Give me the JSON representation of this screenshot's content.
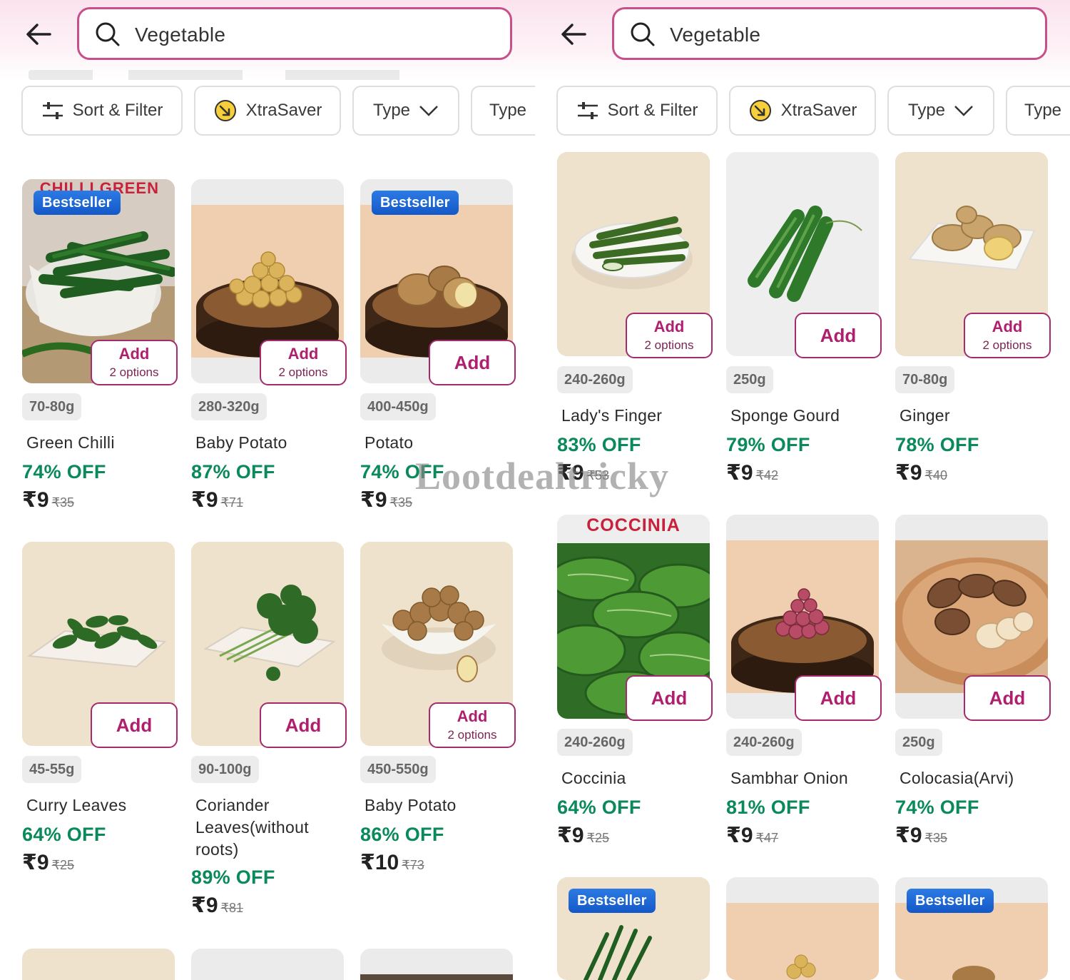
{
  "search": {
    "value": "Vegetable"
  },
  "filters": {
    "sort": "Sort & Filter",
    "xtra": "XtraSaver",
    "type": "Type",
    "type2": "Type"
  },
  "labels": {
    "bestseller": "Bestseller",
    "add": "Add",
    "options": "2 options"
  },
  "watermark": "Lootdealtricky",
  "banners": {
    "chilli": "CHILLI GREEN",
    "coccinia": "COCCINIA"
  },
  "colors": {
    "accent": "#b01f6e",
    "discount": "#0a8a5b",
    "badge": "#1f6ad8"
  },
  "left_products": [
    {
      "weight": "70-80g",
      "name": "Green Chilli",
      "off": "74% OFF",
      "price": "₹9",
      "mrp": "₹35"
    },
    {
      "weight": "280-320g",
      "name": "Baby Potato",
      "off": "87% OFF",
      "price": "₹9",
      "mrp": "₹71"
    },
    {
      "weight": "400-450g",
      "name": "Potato",
      "off": "74% OFF",
      "price": "₹9",
      "mrp": "₹35"
    },
    {
      "weight": "45-55g",
      "name": "Curry Leaves",
      "off": "64% OFF",
      "price": "₹9",
      "mrp": "₹25"
    },
    {
      "weight": "90-100g",
      "name": "Coriander Leaves(without roots)",
      "off": "89% OFF",
      "price": "₹9",
      "mrp": "₹81"
    },
    {
      "weight": "450-550g",
      "name": "Baby Potato",
      "off": "86% OFF",
      "price": "₹10",
      "mrp": "₹73"
    }
  ],
  "right_products": [
    {
      "weight": "240-260g",
      "name": "Lady's Finger",
      "off": "83% OFF",
      "price": "₹9",
      "mrp": "₹53"
    },
    {
      "weight": "250g",
      "name": "Sponge Gourd",
      "off": "79% OFF",
      "price": "₹9",
      "mrp": "₹42"
    },
    {
      "weight": "70-80g",
      "name": "Ginger",
      "off": "78% OFF",
      "price": "₹9",
      "mrp": "₹40"
    },
    {
      "weight": "240-260g",
      "name": "Coccinia",
      "off": "64% OFF",
      "price": "₹9",
      "mrp": "₹25"
    },
    {
      "weight": "240-260g",
      "name": "Sambhar Onion",
      "off": "81% OFF",
      "price": "₹9",
      "mrp": "₹47"
    },
    {
      "weight": "250g",
      "name": "Colocasia(Arvi)",
      "off": "74% OFF",
      "price": "₹9",
      "mrp": "₹35"
    }
  ]
}
